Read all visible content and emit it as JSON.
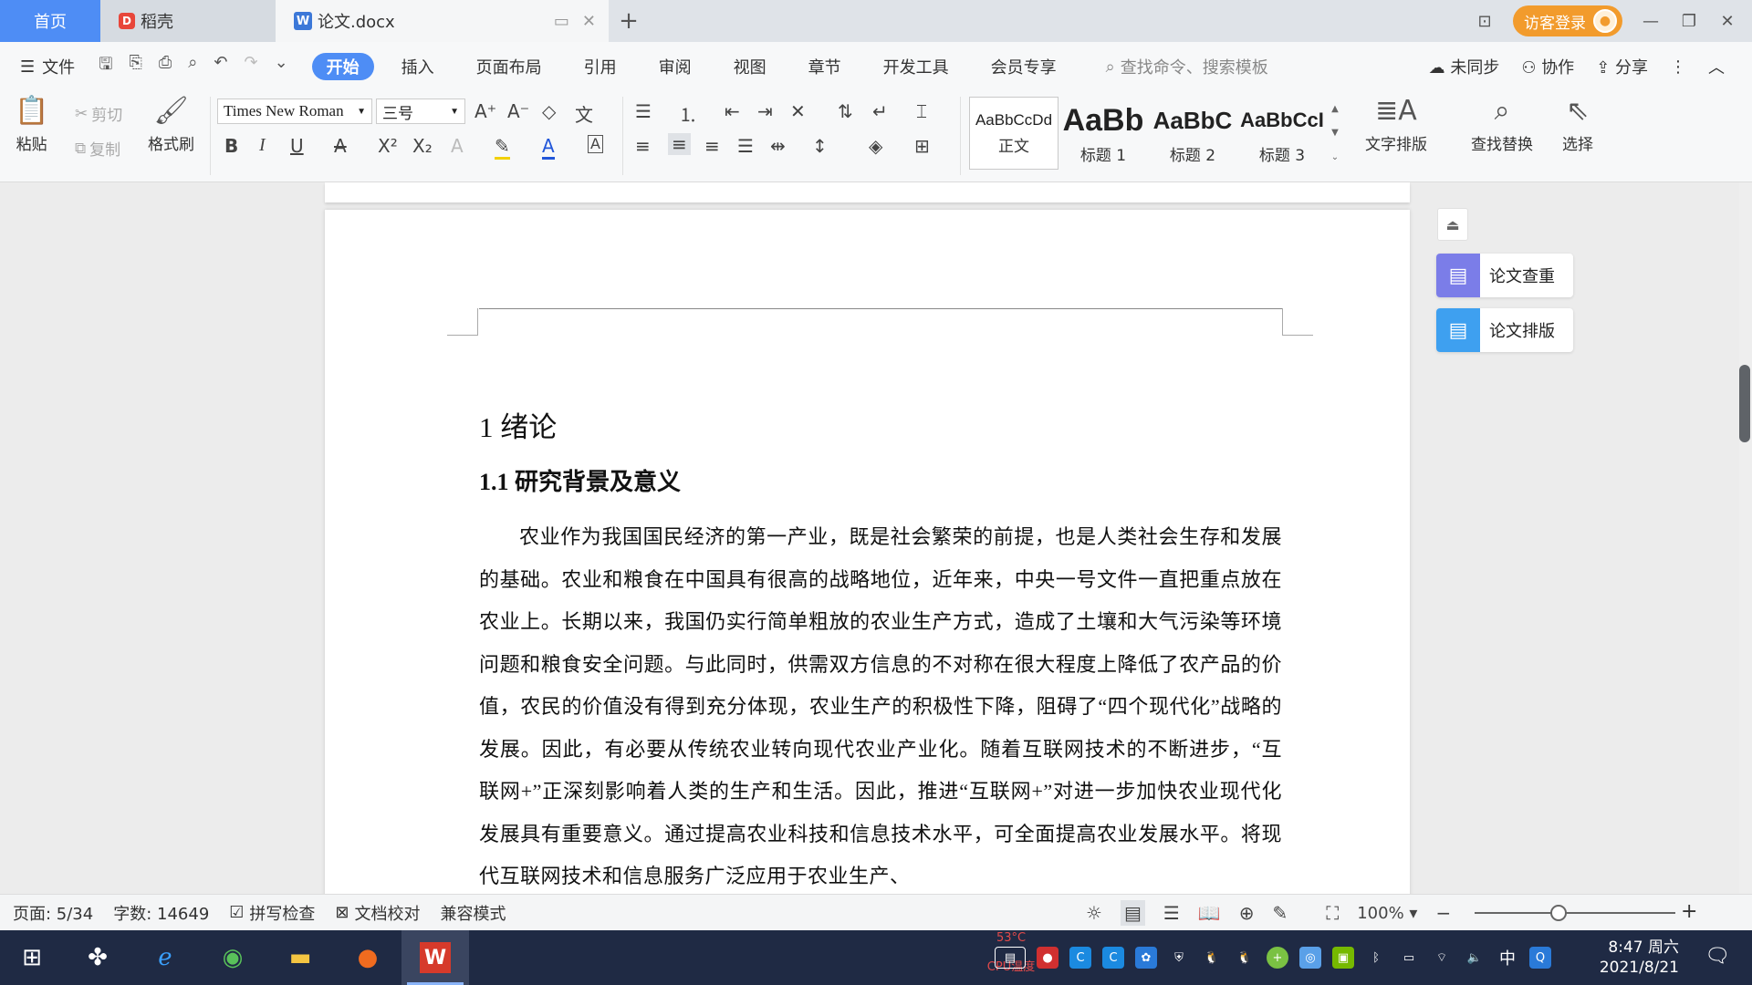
{
  "tabs": {
    "home": "首页",
    "daoke": "稻壳",
    "doc": "论文.docx"
  },
  "titlebar": {
    "login": "访客登录"
  },
  "menu": {
    "file": "文件",
    "tabs": [
      "开始",
      "插入",
      "页面布局",
      "引用",
      "审阅",
      "视图",
      "章节",
      "开发工具",
      "会员专享"
    ],
    "search_placeholder": "查找命令、搜索模板",
    "sync": "未同步",
    "collab": "协作",
    "share": "分享"
  },
  "ribbon": {
    "paste": "粘贴",
    "cut": "剪切",
    "copy": "复制",
    "format_painter": "格式刷",
    "font_name": "Times New Roman",
    "font_size": "三号",
    "styles": [
      {
        "sample": "AaBbCcDd",
        "label": "正文"
      },
      {
        "sample": "AaBb",
        "label": "标题 1"
      },
      {
        "sample": "AaBbC",
        "label": "标题 2"
      },
      {
        "sample": "AaBbCcI",
        "label": "标题 3"
      }
    ],
    "text_layout": "文字排版",
    "find_replace": "查找替换",
    "select": "选择"
  },
  "document": {
    "heading1": "1 绪论",
    "heading2": "1.1 研究背景及意义",
    "paragraph": "农业作为我国国民经济的第一产业，既是社会繁荣的前提，也是人类社会生存和发展的基础。农业和粮食在中国具有很高的战略地位，近年来，中央一号文件一直把重点放在农业上。长期以来，我国仍实行简单粗放的农业生产方式，造成了土壤和大气污染等环境问题和粮食安全问题。与此同时，供需双方信息的不对称在很大程度上降低了农产品的价值，农民的价值没有得到充分体现，农业生产的积极性下降，阻碍了“四个现代化”战略的发展。因此，有必要从传统农业转向现代农业产业化。随着互联网技术的不断进步，“互联网+”正深刻影响着人类的生产和生活。因此，推进“互联网+”对进一步加快农业现代化发展具有重要意义。通过提高农业科技和信息技术水平，可全面提高农业发展水平。将现代互联网技术和信息服务广泛应用于农业生产、"
  },
  "sidepanel": {
    "check": "论文查重",
    "layout": "论文排版"
  },
  "status": {
    "page": "页面: 5/34",
    "words": "字数: 14649",
    "spell": "拼写检查",
    "proofread": "文档校对",
    "compat": "兼容模式",
    "zoom": "100%",
    "zoom_fraction": 0.42
  },
  "taskbar": {
    "cpu_temp": "53°C",
    "cpu_label": "CPU温度",
    "ime": "中",
    "time": "8:47 周六",
    "date": "2021/8/21"
  },
  "colors": {
    "accent": "#4e8df5",
    "login": "#f29b2c",
    "taskbar": "#1f2a44",
    "check_icon": "#7b7de8",
    "layout_icon": "#3ea0f0"
  }
}
